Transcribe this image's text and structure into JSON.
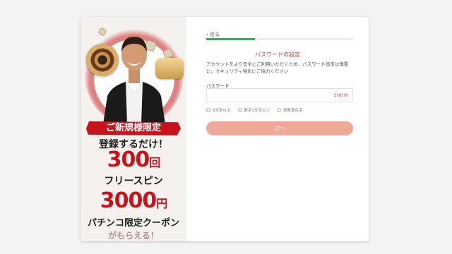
{
  "promo": {
    "ribbon": "ご新規様限定",
    "register_line": "登録するだけ！",
    "spins_number": "300",
    "spins_unit": "回",
    "spins_label": "フリースピン",
    "coupon_number": "3000",
    "coupon_unit": "円",
    "coupon_label": "パチンコ限定クーポン",
    "closing": "がもらえる！"
  },
  "form": {
    "back_label": "戻る",
    "progress": 0.33,
    "title": "パスワードの設定",
    "description": "アカウントをより安全にご利用いただくため、パスワード設定は慎重に。セキュリティ強化にご協力ください",
    "password_label": "パスワード",
    "password_value": "",
    "show_label": "SHOW",
    "requirements": [
      "8文字以上",
      "数字1文字以上",
      "英数混在字"
    ],
    "next_label": "次へ"
  },
  "colors": {
    "accent_red": "#c6141d",
    "title_red": "#c0393a",
    "progress_green": "#4aa06b",
    "button_salmon": "#efa998"
  }
}
